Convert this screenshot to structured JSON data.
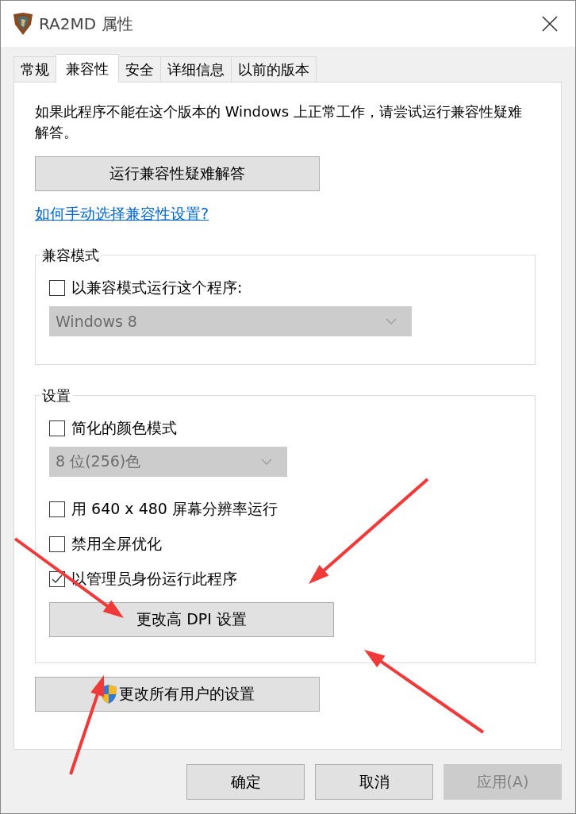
{
  "window": {
    "title": "RA2MD 属性"
  },
  "tabs": [
    {
      "label": "常规",
      "selected": false
    },
    {
      "label": "兼容性",
      "selected": true
    },
    {
      "label": "安全",
      "selected": false
    },
    {
      "label": "详细信息",
      "selected": false
    },
    {
      "label": "以前的版本",
      "selected": false
    }
  ],
  "description": "如果此程序不能在这个版本的 Windows 上正常工作，请尝试运行兼容性疑难解答。",
  "troubleshoot_button": "运行兼容性疑难解答",
  "help_link": "如何手动选择兼容性设置?",
  "compat_mode": {
    "title": "兼容模式",
    "items": [
      {
        "kind": "checkbox",
        "label": "以兼容模式运行这个程序:",
        "checked": false
      },
      {
        "kind": "dropdown",
        "value": "Windows 8",
        "disabled": true
      }
    ]
  },
  "settings": {
    "title": "设置",
    "items": [
      {
        "kind": "checkbox",
        "label": "简化的颜色模式",
        "checked": false
      },
      {
        "kind": "dropdown",
        "value": "8 位(256)色",
        "disabled": true
      },
      {
        "kind": "checkbox",
        "label": "用 640 x 480 屏幕分辨率运行",
        "checked": false
      },
      {
        "kind": "checkbox",
        "label": "禁用全屏优化",
        "checked": false
      },
      {
        "kind": "checkbox",
        "label": "以管理员身份运行此程序",
        "checked": true
      },
      {
        "kind": "button",
        "label": "更改高 DPI 设置"
      }
    ]
  },
  "all_users_button": "更改所有用户的设置",
  "buttons": [
    {
      "label": "确定",
      "disabled": false
    },
    {
      "label": "取消",
      "disabled": false
    },
    {
      "label": "应用(A)",
      "disabled": true
    }
  ]
}
